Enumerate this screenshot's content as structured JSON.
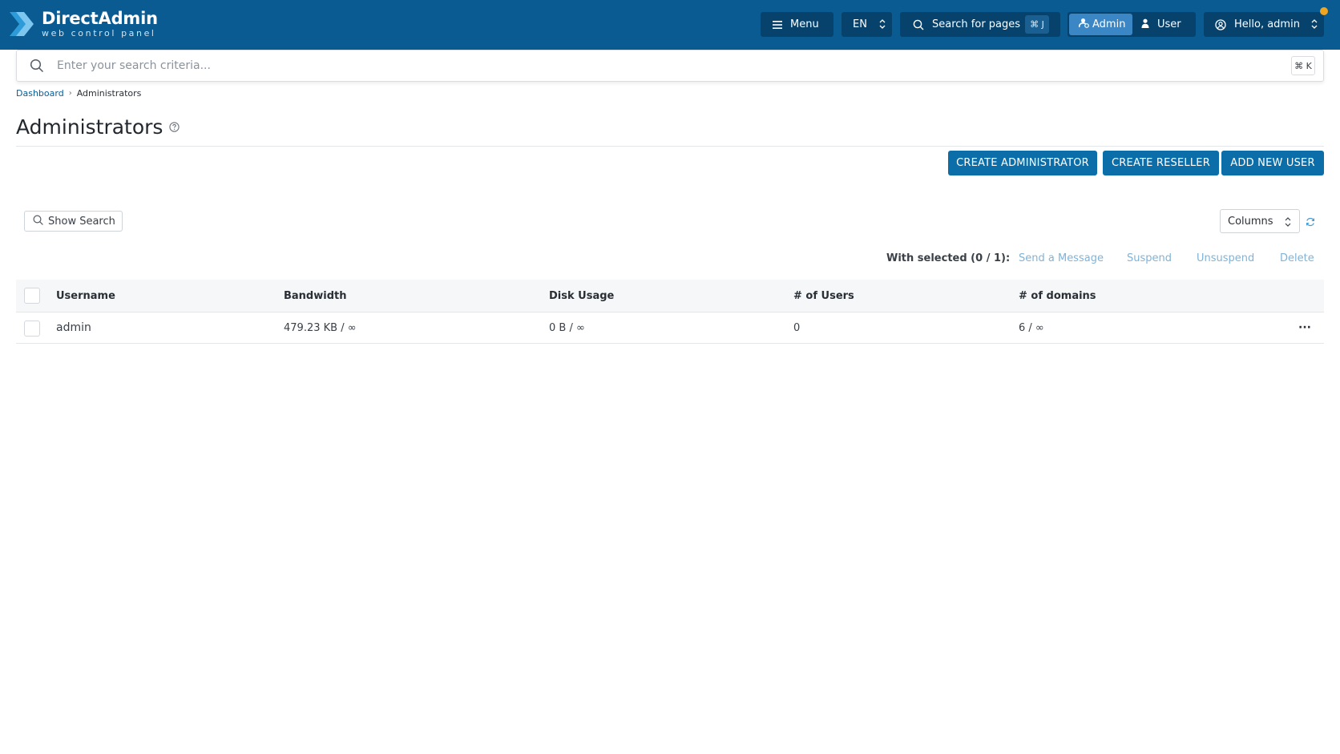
{
  "brand": {
    "name": "DirectAdmin",
    "tagline": "web control panel",
    "colors": {
      "topbar": "#0b5b93",
      "button": "#0b6ea8",
      "accent": "#3b86c4",
      "notification": "#f0a520"
    }
  },
  "topbar": {
    "menu_label": "Menu",
    "menu_icon": "hamburger-icon",
    "language": "EN",
    "page_search_label": "Search for pages",
    "page_search_shortcut": "⌘ J",
    "roles": {
      "admin": "Admin",
      "user": "User",
      "active": "admin"
    },
    "greeting": "Hello, admin"
  },
  "search": {
    "placeholder": "Enter your search criteria...",
    "shortcut": "⌘ K"
  },
  "breadcrumb": {
    "items": [
      "Dashboard",
      "Administrators"
    ],
    "separator": "›"
  },
  "page": {
    "title": "Administrators"
  },
  "actions": {
    "create_admin": "CREATE ADMINISTRATOR",
    "create_reseller": "CREATE RESELLER",
    "add_user": "ADD NEW USER"
  },
  "toolbar": {
    "show_search": "Show Search",
    "columns": "Columns",
    "with_selected": "With selected (0 / 1):",
    "bulk_actions": [
      "Send a Message",
      "Suspend",
      "Unsuspend",
      "Delete"
    ]
  },
  "table": {
    "columns": [
      "Username",
      "Bandwidth",
      "Disk Usage",
      "# of Users",
      "# of domains"
    ],
    "rows": [
      {
        "username": "admin",
        "bandwidth": "479.23 KB / ∞",
        "disk_usage": "0 B / ∞",
        "users": "0",
        "domains": "6 / ∞",
        "menu": "···"
      }
    ]
  }
}
